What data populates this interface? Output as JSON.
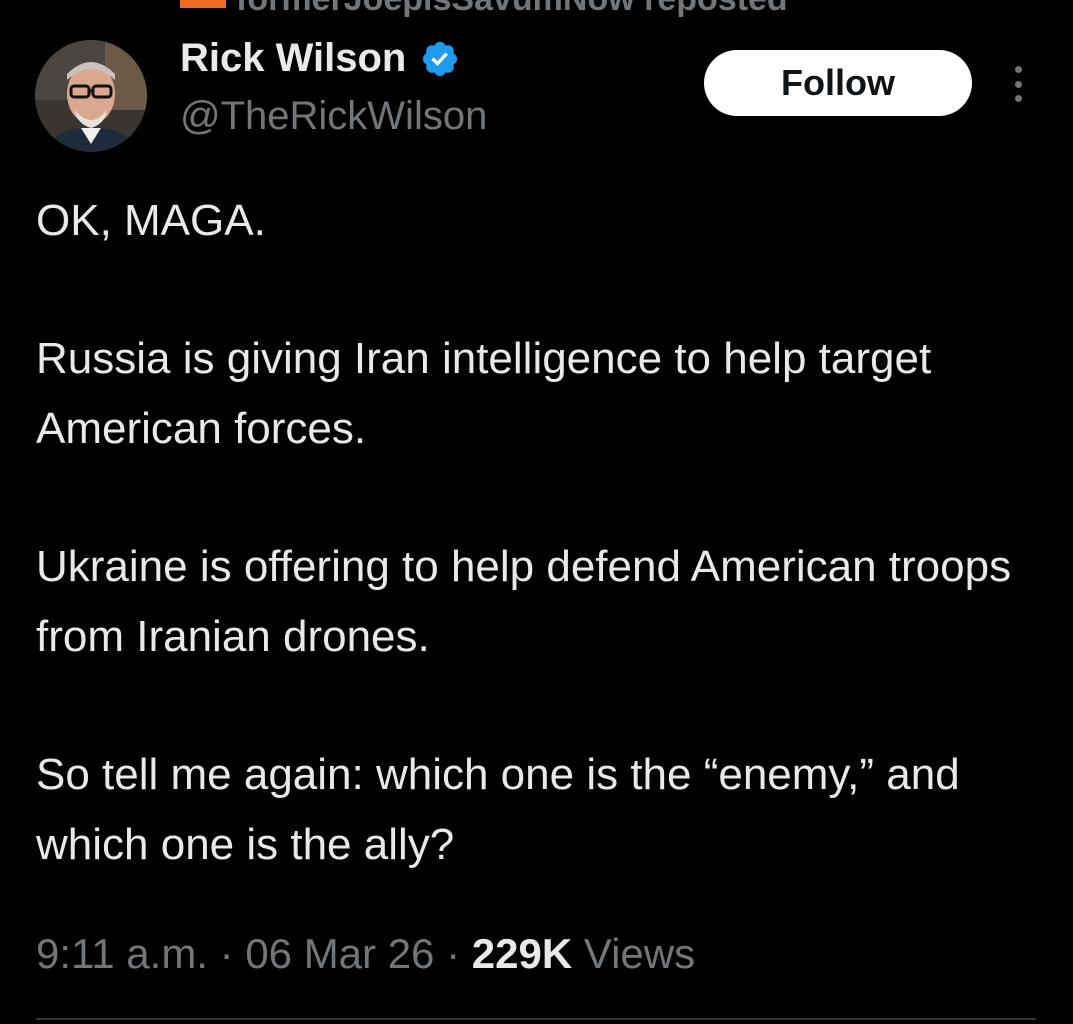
{
  "repost": {
    "text": "formerJoeplsSavumNow reposted",
    "icon": "repost-icon",
    "icon_color": "#f26b21"
  },
  "author": {
    "name": "Rick Wilson",
    "handle": "@TheRickWilson",
    "verified": true,
    "verified_color": "#1d9bf0",
    "avatar": "profile-photo"
  },
  "actions": {
    "follow_label": "Follow",
    "more_icon": "more-options-icon"
  },
  "tweet": {
    "paragraphs": [
      "OK, MAGA.",
      "Russia is giving Iran intelligence to help target American forces.",
      "Ukraine is offering to help defend American troops from Iranian drones.",
      "So tell me again: which one is the “enemy,” and which one is the ally?"
    ]
  },
  "meta": {
    "time": "9:11 a.m.",
    "separator": " · ",
    "date": "06 Mar 26",
    "views_count": "229K",
    "views_label": "Views"
  },
  "colors": {
    "background": "#000000",
    "primary_text": "#e7e9ea",
    "secondary_text": "#71767b",
    "follow_button_bg": "#ffffff"
  }
}
